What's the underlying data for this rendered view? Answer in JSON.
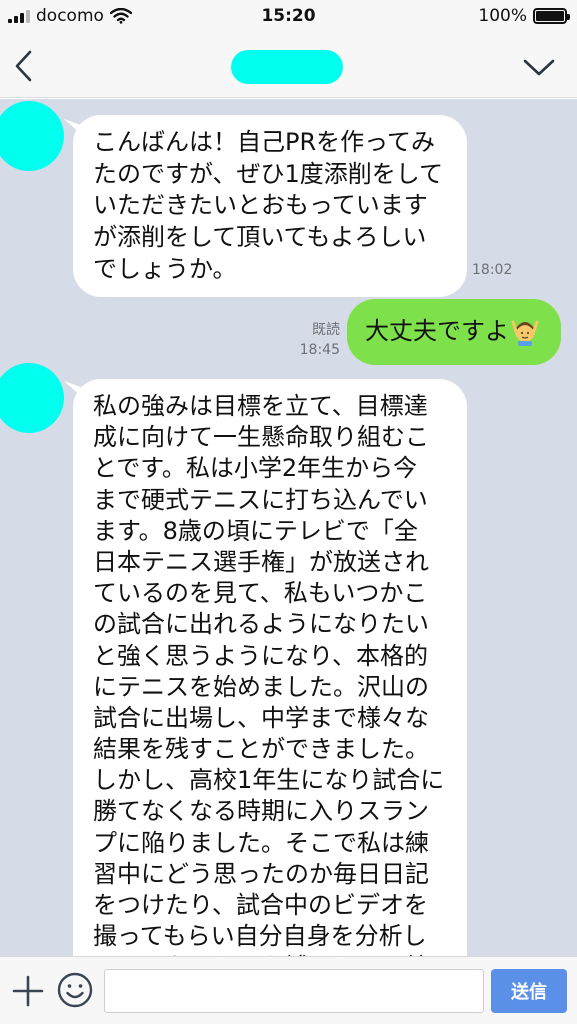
{
  "status_bar": {
    "carrier": "docomo",
    "time": "15:20",
    "battery": "100%"
  },
  "header": {
    "back_icon": "chevron-left-icon",
    "menu_icon": "chevron-down-icon"
  },
  "messages": [
    {
      "direction": "incoming",
      "text": "こんばんは！自己PRを作ってみ\nたのですが、ぜひ1度添削をして\nいただきたいとおもっています\nが添削をして頂いてもよろしい\nでしょうか。",
      "time": "18:02"
    },
    {
      "direction": "outgoing",
      "text": "大丈夫ですよ",
      "emoji": "person-gesturing-ok-emoji",
      "read": "既読",
      "time": "18:45"
    },
    {
      "direction": "incoming",
      "text": "私の強みは目標を立て、目標達\n成に向けて一生懸命取り組むこ\nとです。私は小学2年生から今\nまで硬式テニスに打ち込んでい\nます。8歳の頃にテレビで「全\n日本テニス選手権」が放送され\nているのを見て、私もいつかこ\nの試合に出れるようになりたい\nと強く思うようになり、本格的\nにテニスを始めました。沢山の\n試合に出場し、中学まで様々な\n結果を残すことができました。\nしかし、高校1年生になり試合に\n勝てなくなる時期に入りスラン\nプに陥りました。そこで私は練\n習中にどう思ったのか毎日日記\nをつけたり、試合中のビデオを\n撮ってもらい自分自身を分析し\nて足りないものを補うために練\n習を重ねたり、県外へ遠征に行"
    }
  ],
  "input_bar": {
    "plus_icon": "plus-icon",
    "emoji_icon": "smiley-icon",
    "placeholder": "",
    "send_label": "送信"
  },
  "colors": {
    "chat_background": "#d6dce7",
    "outgoing_bubble": "#7ee04a",
    "incoming_bubble": "#ffffff",
    "send_button": "#5b90e8",
    "avatar_mask": "#00ffee"
  }
}
